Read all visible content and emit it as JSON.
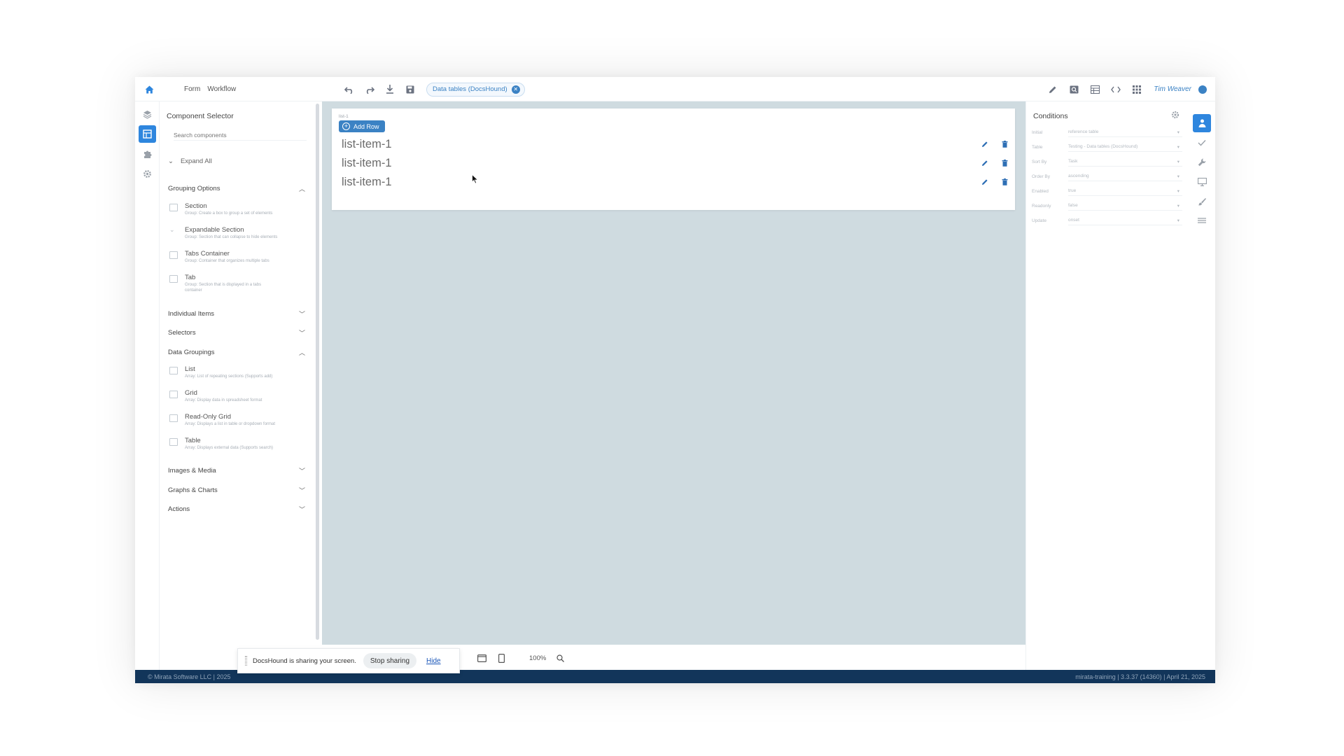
{
  "topbar": {
    "links": [
      "Form",
      "Workflow"
    ],
    "chip_label": "Data tables (DocsHound)",
    "user_name": "Tim Weaver"
  },
  "component_selector": {
    "title": "Component Selector",
    "search_placeholder": "Search components",
    "expand_all": "Expand All",
    "categories": {
      "grouping_options": "Grouping Options",
      "individual_items": "Individual Items",
      "selectors": "Selectors",
      "data_groupings": "Data Groupings",
      "images_media": "Images & Media",
      "graphs_charts": "Graphs & Charts",
      "actions": "Actions"
    },
    "grouping_items": [
      {
        "name": "Section",
        "desc": "Group: Create a box to group a set of elements"
      },
      {
        "name": "Expandable Section",
        "desc": "Group: Section that can collapse to hide elements"
      },
      {
        "name": "Tabs Container",
        "desc": "Group: Container that organizes multiple tabs"
      },
      {
        "name": "Tab",
        "desc": "Group: Section that is displayed in a tabs container"
      }
    ],
    "data_items": [
      {
        "name": "List",
        "desc": "Array: List of repeating sections (Supports add)"
      },
      {
        "name": "Grid",
        "desc": "Array: Display data in spreadsheet format"
      },
      {
        "name": "Read-Only Grid",
        "desc": "Array: Displays a list in table or dropdown format"
      },
      {
        "name": "Table",
        "desc": "Array: Displays external data (Supports search)"
      }
    ]
  },
  "canvas": {
    "card_label": "list-1",
    "add_row_label": "Add Row",
    "rows": [
      "list-item-1",
      "list-item-1",
      "list-item-1"
    ]
  },
  "conditions": {
    "title": "Conditions",
    "fields": [
      {
        "label": "Initial",
        "value": "reference table"
      },
      {
        "label": "Table",
        "value": "Testing - Data tables (DocsHound)"
      },
      {
        "label": "Sort By",
        "value": "Task"
      },
      {
        "label": "Order By",
        "value": "ascending"
      },
      {
        "label": "Enabled",
        "value": "true"
      },
      {
        "label": "Readonly",
        "value": "false"
      },
      {
        "label": "Update",
        "value": "onset"
      }
    ]
  },
  "share_bar": {
    "message": "DocsHound is sharing your screen.",
    "stop_label": "Stop sharing",
    "hide_label": "Hide"
  },
  "zoom": "100%",
  "status": {
    "left": "© Mirata Software LLC | 2025",
    "right": "mirata-training | 3.3.37 (14360) | April 21, 2025"
  },
  "colors": {
    "accent": "#2e86de",
    "statusbar": "#12355a",
    "canvas": "#cfdbe0"
  }
}
